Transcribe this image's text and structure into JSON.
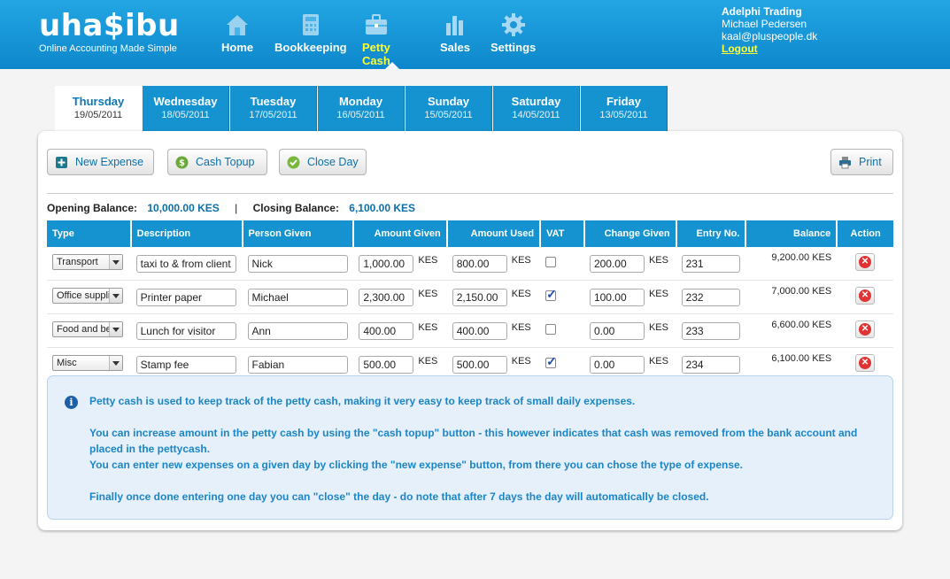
{
  "brand": {
    "name": "uha$ibu",
    "tagline": "Online Accounting Made Simple"
  },
  "nav": [
    {
      "label": "Home",
      "icon": "home-icon"
    },
    {
      "label": "Bookkeeping",
      "icon": "calculator-icon"
    },
    {
      "label": "Petty Cash",
      "icon": "briefcase-icon",
      "active": true
    },
    {
      "label": "Sales",
      "icon": "bar-chart-icon"
    },
    {
      "label": "Settings",
      "icon": "gear-icon"
    }
  ],
  "user": {
    "company": "Adelphi Trading",
    "name": "Michael Pedersen",
    "email": "kaal@pluspeople.dk",
    "logout": "Logout"
  },
  "tabs": [
    {
      "day": "Thursday",
      "date": "19/05/2011",
      "active": true
    },
    {
      "day": "Wednesday",
      "date": "18/05/2011"
    },
    {
      "day": "Tuesday",
      "date": "17/05/2011"
    },
    {
      "day": "Monday",
      "date": "16/05/2011"
    },
    {
      "day": "Sunday",
      "date": "15/05/2011"
    },
    {
      "day": "Saturday",
      "date": "14/05/2011"
    },
    {
      "day": "Friday",
      "date": "13/05/2011"
    }
  ],
  "toolbar": {
    "new_expense": "New Expense",
    "cash_topup": "Cash Topup",
    "close_day": "Close Day",
    "print": "Print"
  },
  "balances": {
    "opening_label": "Opening Balance:",
    "opening_value": "10,000.00 KES",
    "separator": "|",
    "closing_label": "Closing Balance:",
    "closing_value": "6,100.00 KES"
  },
  "table": {
    "headers": [
      "Type",
      "Description",
      "Person Given",
      "Amount Given",
      "Amount Used",
      "VAT",
      "Change Given",
      "Entry No.",
      "Balance",
      "Action"
    ],
    "currency": "KES",
    "rows": [
      {
        "type": "Transport",
        "description": "taxi to & from client",
        "person": "Nick",
        "given": "1,000.00",
        "used": "800.00",
        "vat": false,
        "change": "200.00",
        "entry": "231",
        "balance": "9,200.00 KES"
      },
      {
        "type": "Office supplies",
        "description": "Printer paper",
        "person": "Michael",
        "given": "2,300.00",
        "used": "2,150.00",
        "vat": true,
        "change": "100.00",
        "entry": "232",
        "balance": "7,000.00 KES"
      },
      {
        "type": "Food and beverages",
        "description": "Lunch for visitor",
        "person": "Ann",
        "given": "400.00",
        "used": "400.00",
        "vat": false,
        "change": "0.00",
        "entry": "233",
        "balance": "6,600.00 KES"
      },
      {
        "type": "Misc",
        "description": "Stamp fee",
        "person": "Fabian",
        "given": "500.00",
        "used": "500.00",
        "vat": true,
        "change": "0.00",
        "entry": "234",
        "balance": "6,100.00 KES"
      }
    ]
  },
  "info": {
    "p1": "Petty cash is used to keep track of the petty cash, making it very easy to keep track of small daily expenses.",
    "p2": "You can increase amount in the petty cash by using the \"cash topup\" button - this however indicates that cash was removed from the bank account and placed in the pettycash.",
    "p3": "You can enter new expenses on a given day by clicking the \"new expense\" button, from there you can chose the type of expense.",
    "p4": "Finally once done entering one day you can \"close\" the day - do note that after 7 days the day will automatically be closed."
  }
}
